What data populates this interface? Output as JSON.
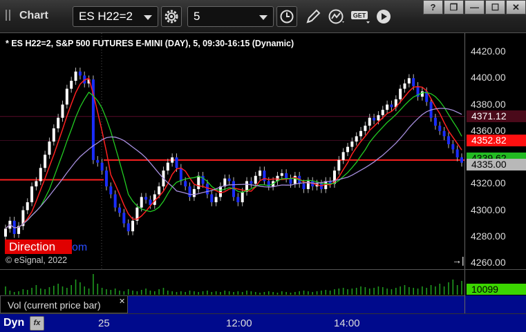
{
  "toolbar": {
    "app_title": "Chart",
    "symbol_value": "ES H22=2",
    "interval_value": "5",
    "buttons": [
      "gear-icon",
      "clock-icon",
      "pen-icon",
      "study-icon",
      "get-icon",
      "play-icon"
    ]
  },
  "window_controls": {
    "help": "?",
    "restore": "❐",
    "minimize": "—",
    "maximize": "☐",
    "close": "✕"
  },
  "chart": {
    "title": "* ES H22=2, S&P 500 FUTURES E-MINI (DAY), 5, 09:30-16:15 (Dynamic)",
    "direction_label": "Direction",
    "direction_tail": "om",
    "copyright": "© eSignal, 2022",
    "price_ticks": [
      "4420.00",
      "4400.00",
      "4380.00",
      "4360.00",
      "4340.00",
      "4320.00",
      "4300.00",
      "4280.00",
      "4260.00"
    ],
    "price_tags": [
      {
        "text": "4371.12",
        "bg": "#4a0a1a",
        "fg": "#ffffff"
      },
      {
        "text": "4352.82",
        "bg": "#ff1010",
        "fg": "#ffffff"
      },
      {
        "text": "4339.62",
        "bg": "#22bb22",
        "fg": "#000000"
      },
      {
        "text": "4335.00",
        "bg": "#b8b8b8",
        "fg": "#000000"
      }
    ]
  },
  "chart_data": {
    "type": "candlestick",
    "symbol": "ES H22=2",
    "interval": "5",
    "ylim": [
      4260,
      4425
    ],
    "x_labels": [
      "25",
      "12:00",
      "14:00"
    ],
    "colors": {
      "up": "#ffffff",
      "down": "#1a2dff",
      "direction_red": "#ff2020",
      "ma_fast": "#22cc22",
      "ma_slow": "#00ff00",
      "lavender": "#a890e0",
      "level_dark_red": "#5a0a2a"
    },
    "candles_close": [
      4286,
      4292,
      4282,
      4288,
      4300,
      4306,
      4318,
      4322,
      4332,
      4342,
      4352,
      4362,
      4370,
      4380,
      4392,
      4398,
      4405,
      4402,
      4396,
      4399,
      4338,
      4336,
      4330,
      4318,
      4312,
      4302,
      4298,
      4290,
      4284,
      4292,
      4302,
      4310,
      4308,
      4304,
      4312,
      4318,
      4330,
      4336,
      4340,
      4332,
      4322,
      4318,
      4310,
      4316,
      4326,
      4320,
      4312,
      4306,
      4310,
      4318,
      4324,
      4322,
      4310,
      4306,
      4314,
      4322,
      4320,
      4326,
      4330,
      4322,
      4318,
      4322,
      4326,
      4328,
      4324,
      4320,
      4326,
      4320,
      4316,
      4322,
      4318,
      4320,
      4316,
      4322,
      4320,
      4330,
      4338,
      4344,
      4348,
      4352,
      4356,
      4360,
      4364,
      4370,
      4368,
      4372,
      4376,
      4380,
      4378,
      4384,
      4392,
      4396,
      4400,
      4394,
      4386,
      4390,
      4382,
      4370,
      4364,
      4360,
      4356,
      4350,
      4346,
      4340,
      4336
    ],
    "volume_bar_label": "10099"
  },
  "volume": {
    "label": "Vol (current price bar)",
    "value": "10099",
    "close_icon": "✕"
  },
  "time_axis": {
    "left_label": "Dyn",
    "fx_icon": "fx",
    "labels": [
      {
        "text": "25"
      },
      {
        "text": "12:00"
      },
      {
        "text": "14:00"
      }
    ]
  }
}
